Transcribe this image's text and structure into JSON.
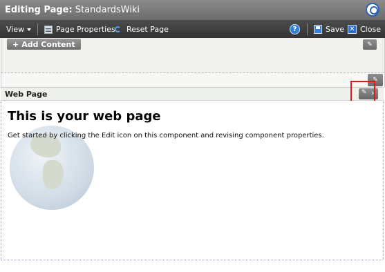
{
  "header": {
    "title_prefix": "Editing Page:",
    "page_name": "StandardsWiki"
  },
  "toolbar": {
    "view_label": "View",
    "page_properties_label": "Page Properties",
    "reset_page_label": "Reset Page",
    "help_glyph": "?",
    "save_label": "Save",
    "close_label": "Close"
  },
  "edit_area": {
    "add_content_label": "Add Content"
  },
  "component": {
    "title": "Web Page",
    "heading": "This is your web page",
    "body": "Get started by clicking the Edit icon on this component and revising component properties."
  },
  "icons": {
    "brand": "oracle-logo-icon",
    "page_properties": "page-properties-icon",
    "reset": "reset-icon",
    "help": "help-icon",
    "save": "save-icon",
    "close": "close-icon",
    "edit": "pencil-icon",
    "globe": "globe-icon"
  },
  "colors": {
    "highlight": "#e01818",
    "header_bg": "#7a7a7a",
    "toolbar_bg": "#3d3d3d"
  }
}
